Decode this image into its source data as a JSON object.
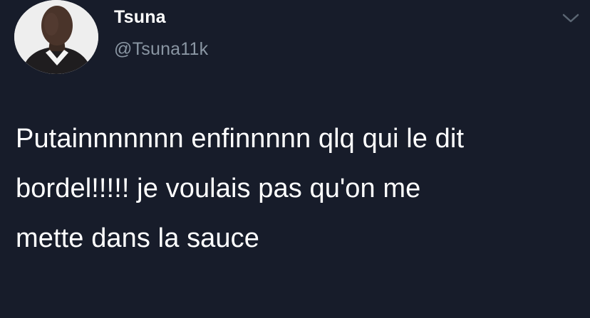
{
  "tweet": {
    "author_name": "Tsuna",
    "author_handle": "@Tsuna11k",
    "avatar_icon": "user-avatar-icon",
    "menu_icon": "chevron-down-icon",
    "text": "Putainnnnnnn enfinnnnn qlq qui le dit\nbordel!!!!! je voulais pas qu'on me\nmette dans la sauce"
  },
  "colors": {
    "background": "#171c2a",
    "primary_text": "#ffffff",
    "secondary_text": "#8a96a3"
  }
}
